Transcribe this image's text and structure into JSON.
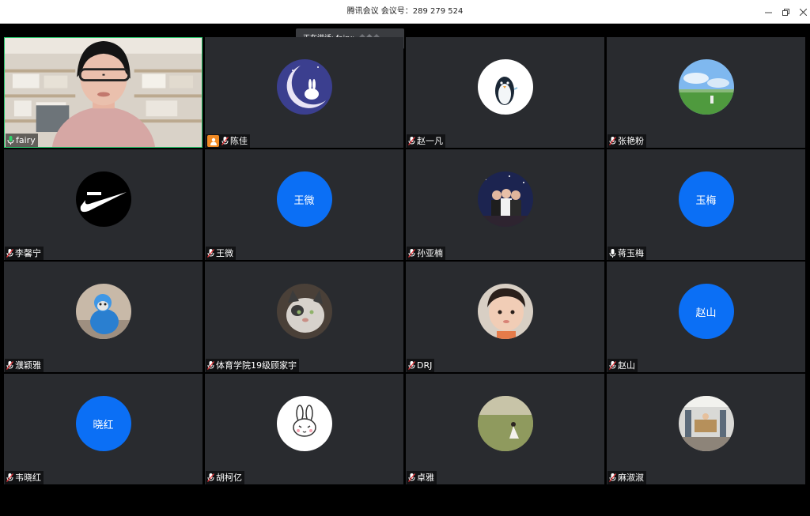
{
  "window": {
    "title": "腾讯会议 会议号：289 279 524",
    "controls": [
      "minimize",
      "restore",
      "close"
    ]
  },
  "speaking": {
    "label": "正在讲话: fairy;"
  },
  "colors": {
    "active_border": "#27c26a",
    "tile_bg": "#292b2f",
    "text_avatar": "#0b6ff5",
    "host_badge": "#f08a24"
  },
  "participants": [
    {
      "name": "fairy",
      "avatar": "camera-video",
      "mic": "on"
    },
    {
      "name": "陈佳",
      "avatar": "moon-rabbit-image",
      "mic": "off",
      "host": true
    },
    {
      "name": "赵一凡",
      "avatar": "penguin-image",
      "mic": "off"
    },
    {
      "name": "张艳粉",
      "avatar": "sky-field-image",
      "mic": "off"
    },
    {
      "name": "李馨宁",
      "avatar": "swoosh-logo-image",
      "mic": "off"
    },
    {
      "name": "王微",
      "avatar_text": "王微",
      "mic": "off"
    },
    {
      "name": "孙亚楠",
      "avatar": "group-photo-image",
      "mic": "off"
    },
    {
      "name": "蒋玉梅",
      "avatar_text": "玉梅",
      "mic": "on"
    },
    {
      "name": "濮颖雅",
      "avatar": "doll-photo-image",
      "mic": "off"
    },
    {
      "name": "体育学院19级顾家宇",
      "avatar": "cat-photo-image",
      "mic": "off"
    },
    {
      "name": "DRJ",
      "avatar": "baby-photo-image",
      "mic": "off"
    },
    {
      "name": "赵山",
      "avatar_text": "赵山",
      "mic": "off"
    },
    {
      "name": "韦晓红",
      "avatar_text": "晓红",
      "mic": "off"
    },
    {
      "name": "胡柯亿",
      "avatar": "bunny-cartoon-image",
      "mic": "off"
    },
    {
      "name": "卓雅",
      "avatar": "girl-field-image",
      "mic": "off"
    },
    {
      "name": "麻淑淑",
      "avatar": "gym-photo-image",
      "mic": "off"
    }
  ]
}
